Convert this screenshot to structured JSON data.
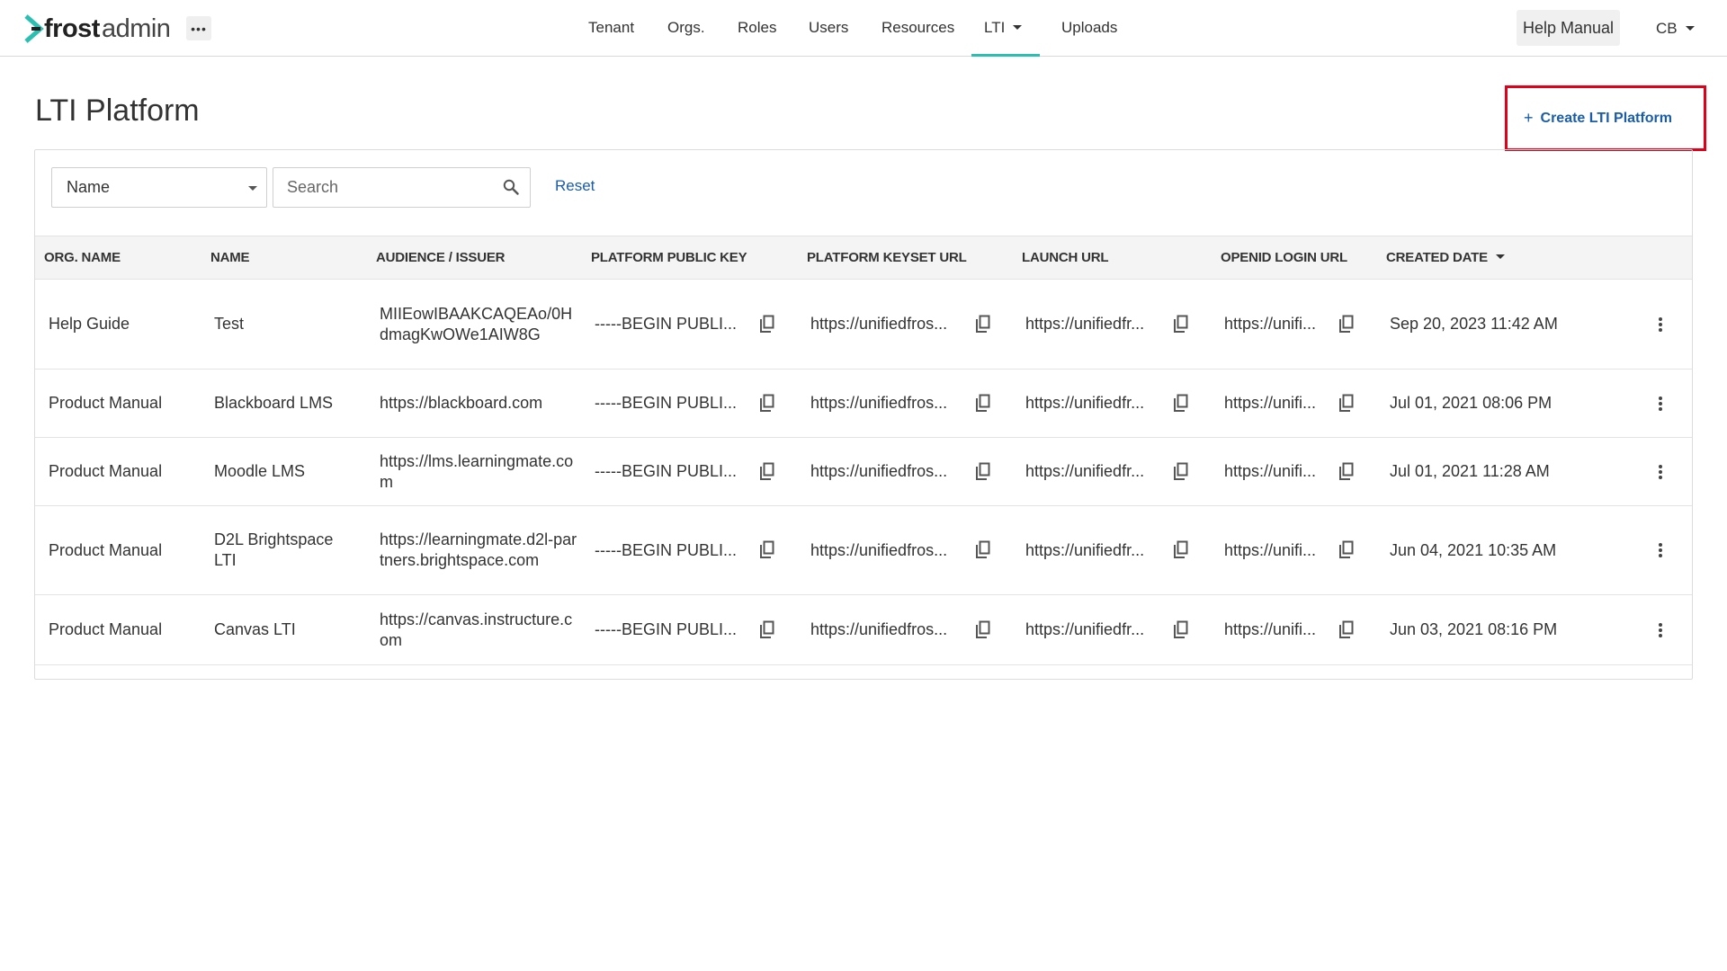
{
  "brand": {
    "bold": "frost",
    "light": "admin",
    "accent_color": "#2bbfb1"
  },
  "nav": {
    "more_label": "•••",
    "items": [
      {
        "label": "Tenant"
      },
      {
        "label": "Orgs."
      },
      {
        "label": "Roles"
      },
      {
        "label": "Users"
      },
      {
        "label": "Resources"
      },
      {
        "label": "LTI",
        "active": true,
        "has_dropdown": true
      },
      {
        "label": "Uploads"
      }
    ],
    "help_label": "Help Manual",
    "user_initials": "CB"
  },
  "page": {
    "title": "LTI Platform",
    "create_label": "Create LTI Platform",
    "create_icon": "plus-icon"
  },
  "filters": {
    "field_value": "Name",
    "search_placeholder": "Search",
    "reset_label": "Reset"
  },
  "table": {
    "columns": [
      "ORG. NAME",
      "NAME",
      "AUDIENCE / ISSUER",
      "PLATFORM PUBLIC KEY",
      "PLATFORM KEYSET URL",
      "LAUNCH URL",
      "OPENID LOGIN URL",
      "CREATED DATE"
    ],
    "sorted_column": "CREATED DATE",
    "sort_direction": "desc",
    "rows": [
      {
        "org": "Help Guide",
        "name": "Test",
        "audience": "MIIEowIBAAKCAQEAo/0HdmagKwOWe1AIW8G",
        "public_key": "-----BEGIN PUBLI...",
        "keyset_url": "https://unifiedfros...",
        "launch_url": "https://unifiedfr...",
        "login_url": "https://unifi...",
        "created": "Sep 20, 2023 11:42 AM"
      },
      {
        "org": "Product Manual",
        "name": "Blackboard LMS",
        "audience": "https://blackboard.com",
        "public_key": "-----BEGIN PUBLI...",
        "keyset_url": "https://unifiedfros...",
        "launch_url": "https://unifiedfr...",
        "login_url": "https://unifi...",
        "created": "Jul 01, 2021 08:06 PM"
      },
      {
        "org": "Product Manual",
        "name": "Moodle LMS",
        "audience": "https://lms.learningmate.com",
        "public_key": "-----BEGIN PUBLI...",
        "keyset_url": "https://unifiedfros...",
        "launch_url": "https://unifiedfr...",
        "login_url": "https://unifi...",
        "created": "Jul 01, 2021 11:28 AM"
      },
      {
        "org": "Product Manual",
        "name": "D2L Brightspace LTI",
        "audience": "https://learningmate.d2l-partners.brightspace.com",
        "public_key": "-----BEGIN PUBLI...",
        "keyset_url": "https://unifiedfros...",
        "launch_url": "https://unifiedfr...",
        "login_url": "https://unifi...",
        "created": "Jun 04, 2021 10:35 AM"
      },
      {
        "org": "Product Manual",
        "name": "Canvas LTI",
        "audience": "https://canvas.instructure.com",
        "public_key": "-----BEGIN PUBLI...",
        "keyset_url": "https://unifiedfros...",
        "launch_url": "https://unifiedfr...",
        "login_url": "https://unifi...",
        "created": "Jun 03, 2021 08:16 PM"
      }
    ]
  },
  "colors": {
    "link": "#1a5da6",
    "highlight_border": "#e0001a",
    "header_bg": "#f4f4f4"
  }
}
